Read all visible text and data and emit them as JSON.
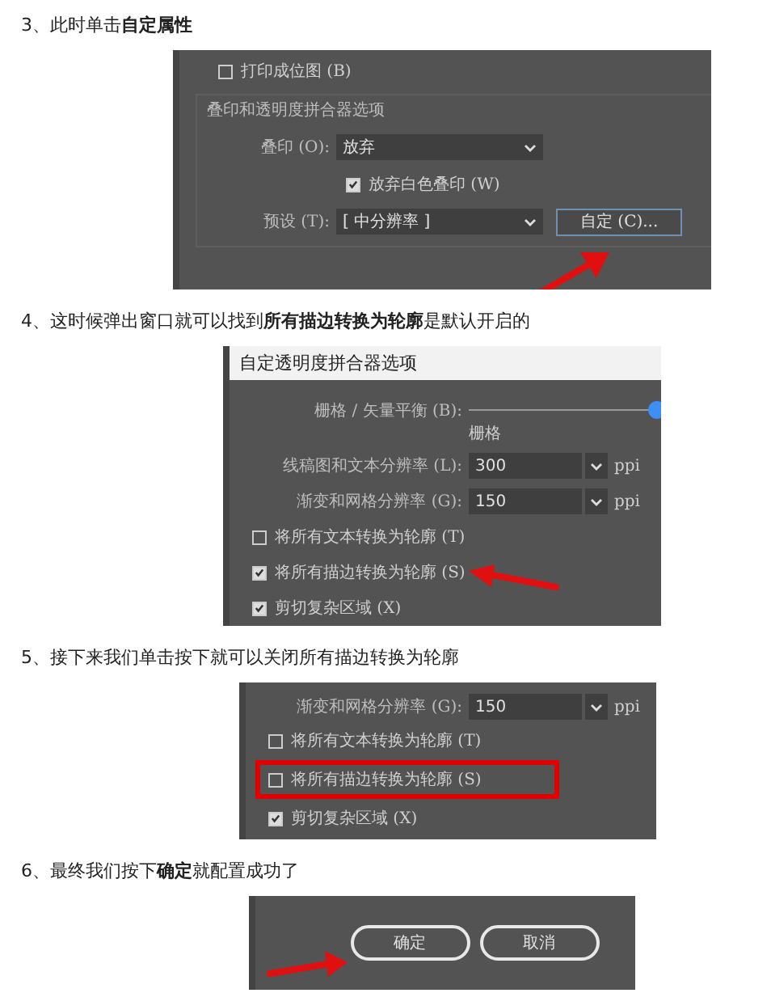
{
  "sections": [
    {
      "instruction": "3、此时单击**自定属性**",
      "screenshot": {
        "rows": [
          {
            "kind": "checkbox",
            "label": "打印成位图 (B)",
            "checked": false,
            "highlighted": false,
            "pointed_at": false
          },
          {
            "kind": "group",
            "title": "叠印和透明度拼合器选项",
            "rows": [
              {
                "kind": "select",
                "label": "叠印 (O):",
                "value": "放弃",
                "pointed_at": false
              },
              {
                "kind": "checkbox",
                "label": "放弃白色叠印 (W)",
                "checked": true,
                "highlighted": false,
                "pointed_at": false
              },
              {
                "kind": "select",
                "label": "预设 (T):",
                "value": "[ 中分辨率 ]",
                "button": "自定 (C)...",
                "pointed_at": true
              }
            ]
          }
        ]
      }
    },
    {
      "instruction": "4、这时候弹出窗口就可以找到**所有描边转换为轮廓**是默认开启的",
      "screenshot": {
        "rows": [
          {
            "kind": "title",
            "text": "自定透明度拼合器选项"
          },
          {
            "kind": "slider",
            "label": "栅格 / 矢量平衡 (B):",
            "level": 1,
            "caption": "栅格"
          },
          {
            "kind": "select",
            "label": "线稿图和文本分辨率 (L):",
            "value": "300",
            "unit": "ppi",
            "pointed_at": false
          },
          {
            "kind": "select",
            "label": "渐变和网格分辨率 (G):",
            "value": "150",
            "unit": "ppi",
            "pointed_at": false
          },
          {
            "kind": "checkbox",
            "label": "将所有文本转换为轮廓 (T)",
            "checked": false,
            "highlighted": false,
            "pointed_at": false
          },
          {
            "kind": "checkbox",
            "label": "将所有描边转换为轮廓 (S)",
            "checked": true,
            "highlighted": false,
            "pointed_at": true
          },
          {
            "kind": "checkbox",
            "label": "剪切复杂区域 (X)",
            "checked": true,
            "highlighted": false,
            "pointed_at": false
          }
        ]
      }
    },
    {
      "instruction": "5、接下来我们单击按下就可以关闭所有描边转换为轮廓",
      "screenshot": {
        "rows": [
          {
            "kind": "select",
            "label": "渐变和网格分辨率 (G):",
            "value": "150",
            "unit": "ppi",
            "pointed_at": false
          },
          {
            "kind": "checkbox",
            "label": "将所有文本转换为轮廓 (T)",
            "checked": false,
            "highlighted": false,
            "pointed_at": false
          },
          {
            "kind": "checkbox",
            "label": "将所有描边转换为轮廓 (S)",
            "checked": false,
            "highlighted": true,
            "pointed_at": false
          },
          {
            "kind": "checkbox",
            "label": "剪切复杂区域 (X)",
            "checked": true,
            "highlighted": false,
            "pointed_at": false
          }
        ]
      }
    },
    {
      "instruction": "6、最终我们按下**确定**就配置成功了",
      "screenshot": {
        "rows": [
          {
            "kind": "buttons",
            "buttons": [
              {
                "label": "确定",
                "pointed_at": true
              },
              {
                "label": "取消",
                "pointed_at": false
              }
            ]
          }
        ]
      }
    }
  ]
}
